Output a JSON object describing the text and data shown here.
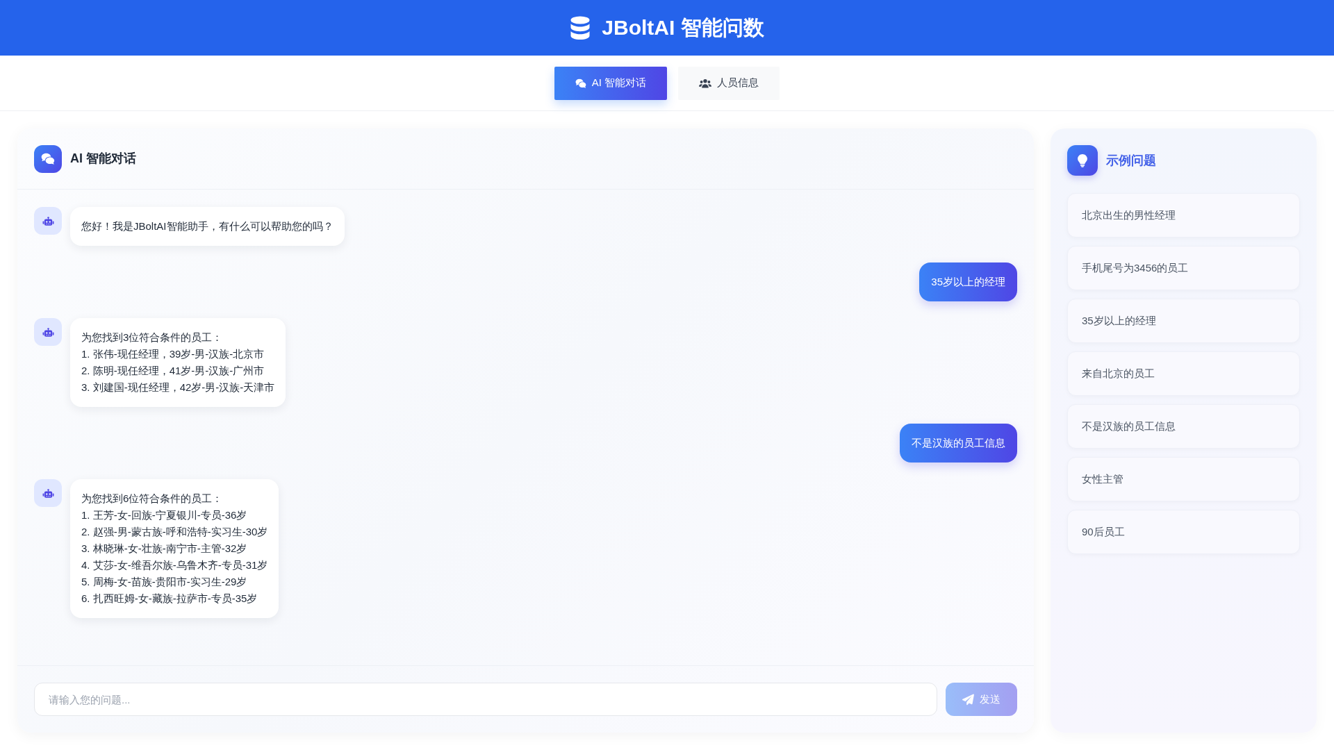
{
  "header": {
    "title": "JBoltAI 智能问数"
  },
  "tabs": [
    {
      "label": "AI 智能对话",
      "selected": true
    },
    {
      "label": "人员信息",
      "selected": false
    }
  ],
  "chat": {
    "title": "AI 智能对话",
    "messages": [
      {
        "kind": "bot",
        "text": "您好！我是JBoltAI智能助手，有什么可以帮助您的吗？"
      },
      {
        "kind": "user",
        "text": "35岁以上的经理"
      },
      {
        "kind": "bot",
        "text": "为您找到3位符合条件的员工：\n1. 张伟-现任经理，39岁-男-汉族-北京市\n2. 陈明-现任经理，41岁-男-汉族-广州市\n3. 刘建国-现任经理，42岁-男-汉族-天津市"
      },
      {
        "kind": "user",
        "text": "不是汉族的员工信息"
      },
      {
        "kind": "bot",
        "text": "为您找到6位符合条件的员工：\n1. 王芳-女-回族-宁夏银川-专员-36岁\n2. 赵强-男-蒙古族-呼和浩特-实习生-30岁\n3. 林晓琳-女-壮族-南宁市-主管-32岁\n4. 艾莎-女-维吾尔族-乌鲁木齐-专员-31岁\n5. 周梅-女-苗族-贵阳市-实习生-29岁\n6. 扎西旺姆-女-藏族-拉萨市-专员-35岁"
      }
    ],
    "input": {
      "placeholder": "请输入您的问题..."
    },
    "send_button": {
      "label": "发送",
      "disabled": true
    }
  },
  "examples": {
    "title": "示例问题",
    "items": [
      "北京出生的男性经理",
      "手机尾号为3456的员工",
      "35岁以上的经理",
      "来自北京的员工",
      "不是汉族的员工信息",
      "女性主管",
      "90后员工"
    ]
  }
}
